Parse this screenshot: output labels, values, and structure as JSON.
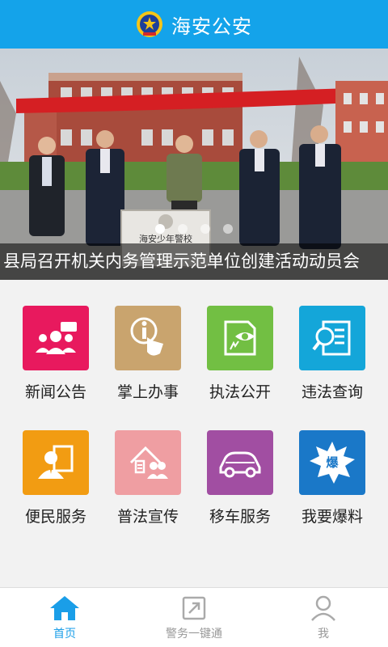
{
  "header": {
    "title": "海安公安",
    "badge_icon": "police-badge-icon"
  },
  "banner": {
    "caption": "县局召开机关内务管理示范单位创建活动动员会",
    "plaque_text": "海安少年警校",
    "slide_count": 4,
    "active_slide": 1
  },
  "menu": {
    "items": [
      {
        "label": "新闻公告",
        "icon": "news-group-icon",
        "color": "#e8195e"
      },
      {
        "label": "掌上办事",
        "icon": "touch-info-icon",
        "color": "#c9a46e"
      },
      {
        "label": "执法公开",
        "icon": "document-eye-icon",
        "color": "#72bf43"
      },
      {
        "label": "违法查询",
        "icon": "search-document-icon",
        "color": "#14a6d9"
      },
      {
        "label": "便民服务",
        "icon": "service-person-icon",
        "color": "#f29c12"
      },
      {
        "label": "普法宣传",
        "icon": "home-community-icon",
        "color": "#ef9ea2"
      },
      {
        "label": "移车服务",
        "icon": "car-icon",
        "color": "#a14ea2"
      },
      {
        "label": "我要爆料",
        "icon": "burst-report-icon",
        "color": "#1a78c8",
        "badge_text": "爆"
      }
    ]
  },
  "nav": {
    "items": [
      {
        "label": "首页",
        "icon": "home-icon",
        "active": true
      },
      {
        "label": "警务一键通",
        "icon": "external-link-icon",
        "active": false
      },
      {
        "label": "我",
        "icon": "user-icon",
        "active": false
      }
    ]
  },
  "colors": {
    "primary": "#14a3ea",
    "nav_active": "#1a9ee8",
    "nav_inactive": "#999999"
  }
}
